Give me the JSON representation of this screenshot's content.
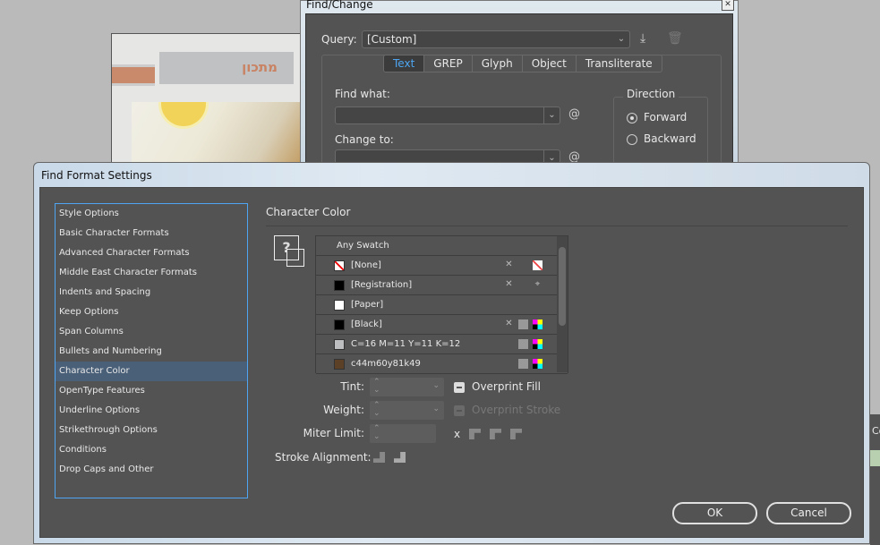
{
  "background_doc": {
    "heading": "מתכון"
  },
  "find_change": {
    "title": "Find/Change",
    "query_label": "Query:",
    "query_value": "[Custom]",
    "tabs": [
      {
        "label": "Text",
        "active": true
      },
      {
        "label": "GREP"
      },
      {
        "label": "Glyph"
      },
      {
        "label": "Object"
      },
      {
        "label": "Transliterate"
      }
    ],
    "find_what_label": "Find what:",
    "find_what_value": "",
    "change_to_label": "Change to:",
    "change_to_value": "",
    "direction_label": "Direction",
    "forward": "Forward",
    "backward": "Backward",
    "direction_selected": "Forward"
  },
  "find_format": {
    "title": "Find Format Settings",
    "categories": [
      "Style Options",
      "Basic Character Formats",
      "Advanced Character Formats",
      "Middle East Character Formats",
      "Indents and Spacing",
      "Keep Options",
      "Span Columns",
      "Bullets and Numbering",
      "Character Color",
      "OpenType Features",
      "Underline Options",
      "Strikethrough Options",
      "Conditions",
      "Drop Caps and Other"
    ],
    "selected_category": "Character Color",
    "section_title": "Character Color",
    "swatches": [
      {
        "name": "Any Swatch"
      },
      {
        "name": "[None]",
        "color": "#ffffff"
      },
      {
        "name": "[Registration]",
        "color": "#000000"
      },
      {
        "name": "[Paper]",
        "color": "#ffffff"
      },
      {
        "name": "[Black]",
        "color": "#000000"
      },
      {
        "name": "C=16 M=11 Y=11 K=12",
        "color": "#bcbec0"
      },
      {
        "name": "c44m60y81k49",
        "color": "#5c4127"
      }
    ],
    "tint_label": "Tint:",
    "weight_label": "Weight:",
    "miter_label": "Miter Limit:",
    "miter_x": "x",
    "stroke_align_label": "Stroke Alignment:",
    "overprint_fill": "Overprint Fill",
    "overprint_stroke": "Overprint Stroke",
    "ok": "OK",
    "cancel": "Cancel"
  },
  "side_panel": {
    "label": "Co"
  }
}
